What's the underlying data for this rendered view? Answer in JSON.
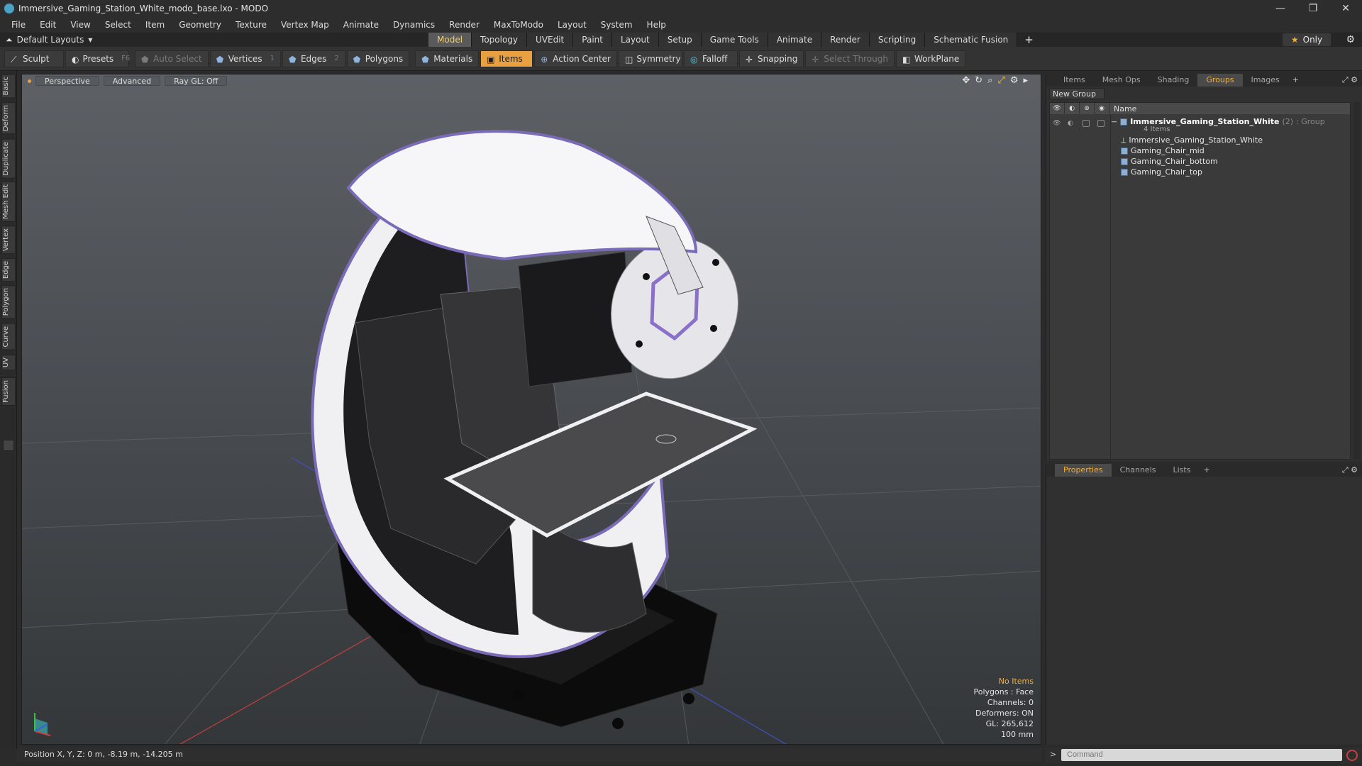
{
  "window": {
    "title": "Immersive_Gaming_Station_White_modo_base.lxo - MODO",
    "min": "—",
    "restore": "❐",
    "close": "✕"
  },
  "menu": [
    "File",
    "Edit",
    "View",
    "Select",
    "Item",
    "Geometry",
    "Texture",
    "Vertex Map",
    "Animate",
    "Dynamics",
    "Render",
    "MaxToModo",
    "Layout",
    "System",
    "Help"
  ],
  "layoutbar": {
    "layouts_label": "Default Layouts",
    "tabs": [
      "Model",
      "Topology",
      "UVEdit",
      "Paint",
      "Layout",
      "Setup",
      "Game Tools",
      "Animate",
      "Render",
      "Scripting",
      "Schematic Fusion"
    ],
    "active_tab": "Model",
    "only_label": "Only"
  },
  "toolbar": {
    "sculpt": "Sculpt",
    "presets": "Presets",
    "presets_key": "F6",
    "auto_select": "Auto Select",
    "vertices": "Vertices",
    "vertices_count": "1",
    "edges": "Edges",
    "edges_count": "2",
    "polygons": "Polygons",
    "materials": "Materials",
    "items": "Items",
    "action_center": "Action Center",
    "symmetry": "Symmetry",
    "falloff": "Falloff",
    "snapping": "Snapping",
    "select_through": "Select Through",
    "workplane": "WorkPlane"
  },
  "left_tabs": [
    "Basic",
    "Deform",
    "Duplicate",
    "Mesh Edit",
    "Vertex",
    "Edge",
    "Polygon",
    "Curve",
    "UV",
    "Fusion"
  ],
  "viewport": {
    "view_mode": "Perspective",
    "shading": "Advanced",
    "raygl": "Ray GL: Off",
    "info": {
      "no_items": "No Items",
      "polygons": "Polygons : Face",
      "channels": "Channels: 0",
      "deformers": "Deformers: ON",
      "gl": "GL: 265,612",
      "scale": "100 mm"
    }
  },
  "scene_panel": {
    "tabs": [
      "Items",
      "Mesh Ops",
      "Shading",
      "Groups",
      "Images"
    ],
    "active_tab": "Groups",
    "new_group": "New Group",
    "header_name": "Name",
    "group": {
      "name": "Immersive_Gaming_Station_White",
      "count": "(2)",
      "type": ": Group",
      "items_label": "4 Items"
    },
    "items": [
      "Immersive_Gaming_Station_White",
      "Gaming_Chair_mid",
      "Gaming_Chair_bottom",
      "Gaming_Chair_top"
    ]
  },
  "properties_panel": {
    "tabs": [
      "Properties",
      "Channels",
      "Lists"
    ],
    "active_tab": "Properties"
  },
  "status": {
    "position": "Position X, Y, Z:  0 m, -8.19 m, -14.205 m"
  },
  "command": {
    "placeholder": "Command"
  },
  "colors": {
    "accent": "#e8a040",
    "active_tab_text": "#f0b040"
  }
}
